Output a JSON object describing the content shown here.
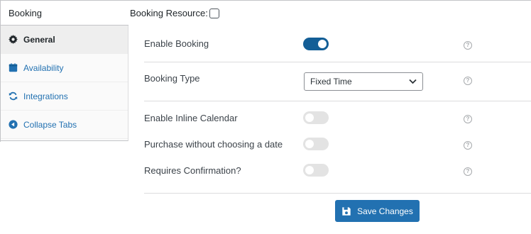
{
  "sidebar": {
    "header": "Booking",
    "tabs": [
      {
        "label": "General",
        "icon": "gear-icon",
        "active": true
      },
      {
        "label": "Availability",
        "icon": "calendar-icon",
        "active": false
      },
      {
        "label": "Integrations",
        "icon": "sync-icon",
        "active": false
      },
      {
        "label": "Collapse Tabs",
        "icon": "collapse-left-icon",
        "active": false
      }
    ]
  },
  "resource": {
    "label": "Booking Resource:",
    "checked": false
  },
  "settings": {
    "enable_booking": {
      "label": "Enable Booking",
      "on": true
    },
    "booking_type": {
      "label": "Booking Type",
      "value": "Fixed Time"
    },
    "inline_calendar": {
      "label": "Enable Inline Calendar",
      "on": false
    },
    "purchase_without_date": {
      "label": "Purchase without choosing a date",
      "on": false
    },
    "requires_confirmation": {
      "label": "Requires Confirmation?",
      "on": false
    },
    "help_glyph": "?"
  },
  "footer": {
    "save_label": "Save Changes"
  },
  "colors": {
    "accent": "#2271b1",
    "toggle_on": "#135e96",
    "toggle_off": "#e3e3e3"
  }
}
